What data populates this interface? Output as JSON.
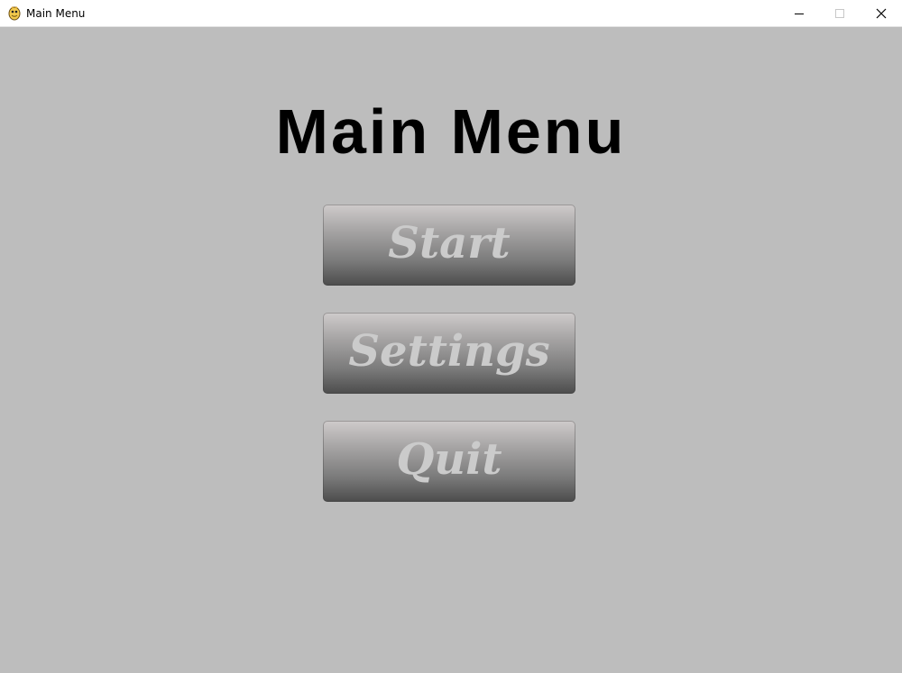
{
  "window": {
    "title": "Main Menu",
    "controls": {
      "minimize_icon": "minimize-icon",
      "maximize_icon": "maximize-icon",
      "close_icon": "close-icon"
    },
    "app_icon": "python-snake-icon"
  },
  "main": {
    "heading": "Main Menu",
    "buttons": [
      {
        "label": "Start"
      },
      {
        "label": "Settings"
      },
      {
        "label": "Quit"
      }
    ]
  },
  "colors": {
    "background": "#bdbdbd",
    "heading_text": "#000000",
    "button_text": "#cbcbcb",
    "button_gradient_top": "#cfcbcb",
    "button_gradient_bottom": "#4c4c4c"
  }
}
